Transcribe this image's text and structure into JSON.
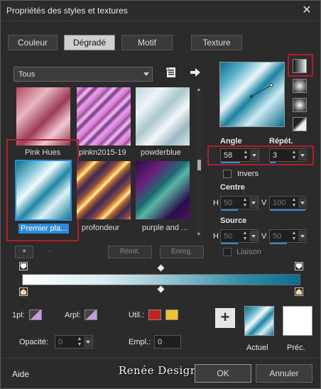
{
  "window": {
    "title": "Propriétés des styles et textures",
    "close": "✕"
  },
  "tabs": [
    {
      "label": "Couleur"
    },
    {
      "label": "Dégradé"
    },
    {
      "label": "Motif"
    },
    {
      "label": "Texture"
    }
  ],
  "category": {
    "value": "Tous"
  },
  "thumbnails": [
    {
      "caption": "Pink Hues"
    },
    {
      "caption": "pinkn2015-19"
    },
    {
      "caption": "powderblue"
    },
    {
      "caption": "Premier pla..."
    },
    {
      "caption": "profondeur"
    },
    {
      "caption": "purple and ..."
    }
  ],
  "list_buttons": {
    "add": "+",
    "remove": "-",
    "reset": "Réinit.",
    "save": "Enreg."
  },
  "angle": {
    "label": "Angle",
    "value": "58"
  },
  "repeat": {
    "label": "Répét.",
    "value": "3"
  },
  "invert": {
    "label": "Invers"
  },
  "centre": {
    "label": "Centre",
    "h_label": "H",
    "h_value": "50",
    "v_label": "V",
    "v_value": "100"
  },
  "source": {
    "label": "Source",
    "h_label": "H",
    "h_value": "50",
    "v_label": "V",
    "v_value": "50"
  },
  "link": {
    "label": "Liaison"
  },
  "stops": {
    "first_label": "1pl:",
    "arpl_label": "Arpl:",
    "util_label": "Util.:",
    "util_colors": [
      "#c0231f",
      "#f2c230"
    ],
    "opacity_label": "Opacité:",
    "opacity_value": "0",
    "empl_label": "Empl.:",
    "empl_value": "0"
  },
  "swatches": {
    "actual_label": "Actuel",
    "prev_label": "Préc."
  },
  "footer": {
    "help": "Aide",
    "watermark": "Renée Design",
    "ok": "OK",
    "cancel": "Annuler"
  },
  "colors": {
    "accent": "#2c8bd8",
    "highlight": "#b01e2c"
  }
}
